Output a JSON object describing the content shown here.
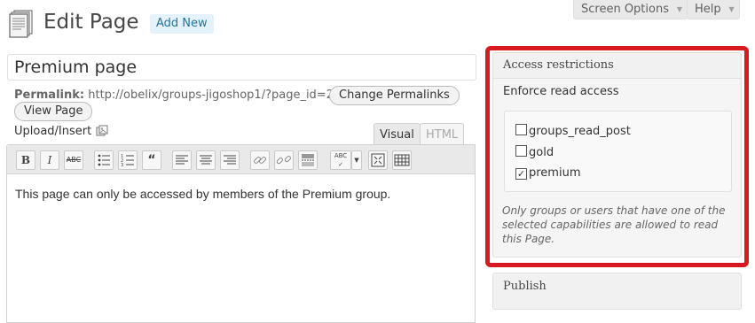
{
  "header": {
    "title": "Edit Page",
    "add_new": "Add New",
    "screen_options": "Screen Options",
    "help": "Help"
  },
  "post": {
    "title": "Premium page",
    "permalink_label": "Permalink:",
    "permalink_url": "http://obelix/groups-jigoshop1/?page_id=22",
    "change_permalinks": "Change Permalinks",
    "view_page": "View Page",
    "upload_insert": "Upload/Insert"
  },
  "editor": {
    "tabs": [
      "Visual",
      "HTML"
    ],
    "active_tab": "Visual",
    "content": "This page can only be accessed by members of the Premium group.",
    "toolbar_buttons": [
      "bold-icon",
      "italic-icon",
      "strikethrough-icon",
      "bullet-list-icon",
      "numbered-list-icon",
      "blockquote-icon",
      "align-left-icon",
      "align-center-icon",
      "align-right-icon",
      "link-icon",
      "unlink-icon",
      "more-tag-icon",
      "spellcheck-icon",
      "fullscreen-icon",
      "kitchen-sink-icon"
    ]
  },
  "access": {
    "title": "Access restrictions",
    "enforce_label": "Enforce read access",
    "capabilities": [
      {
        "label": "groups_read_post",
        "checked": false
      },
      {
        "label": "gold",
        "checked": false
      },
      {
        "label": "premium",
        "checked": true
      }
    ],
    "note": "Only groups or users that have one of the selected capabilities are allowed to read this Page."
  },
  "publish": {
    "title": "Publish"
  },
  "colors": {
    "highlight": "#d71a1f",
    "link": "#21759b"
  }
}
